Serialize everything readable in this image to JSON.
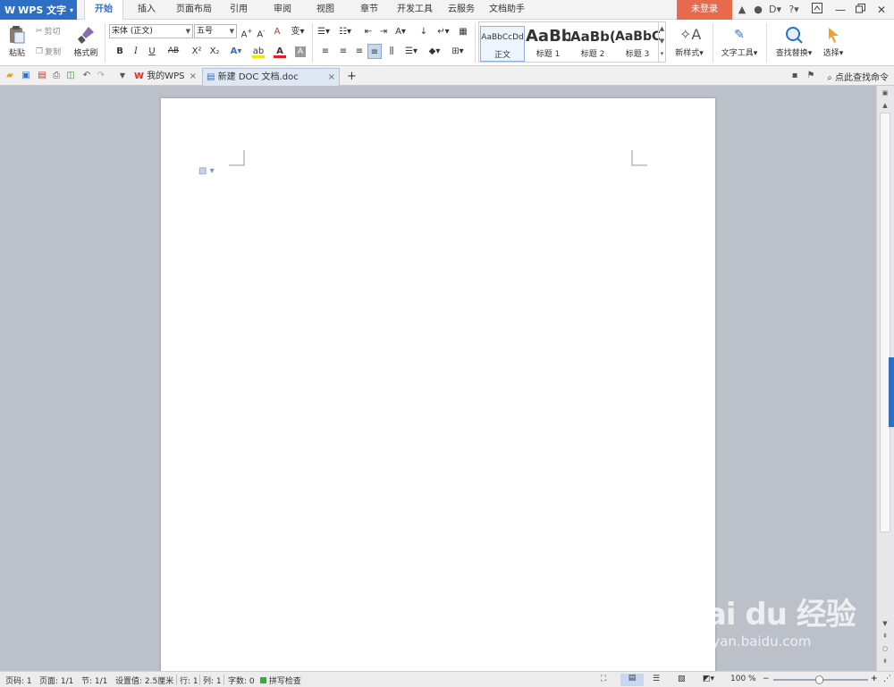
{
  "app": {
    "logo": "W",
    "name": "WPS 文字",
    "menu_arrow": "▾"
  },
  "menu_tabs": [
    {
      "label": "开始",
      "active": true
    },
    {
      "label": "插入"
    },
    {
      "label": "页面布局"
    },
    {
      "label": "引用"
    },
    {
      "label": "审阅"
    },
    {
      "label": "视图"
    },
    {
      "label": "章节"
    },
    {
      "label": "开发工具"
    },
    {
      "label": "云服务"
    },
    {
      "label": "文档助手"
    }
  ],
  "login_label": "未登录",
  "title_icons": [
    "▲",
    "●",
    "D▾",
    "?▾"
  ],
  "ribbon": {
    "paste": "粘贴",
    "cut": "剪切",
    "copy": "复制",
    "format_painter": "格式刷",
    "font_name": "宋体 (正文)",
    "font_size": "五号",
    "bold": "B",
    "italic": "I",
    "underline": "U",
    "strike": "AB",
    "superscript": "X²",
    "subscript": "X₂",
    "styles": [
      {
        "preview": "AaBbCcDd",
        "label": "正文",
        "weight": "normal",
        "size": 10
      },
      {
        "preview": "AaBb",
        "label": "标题 1",
        "weight": "bold",
        "size": 18
      },
      {
        "preview": "AaBb(",
        "label": "标题 2",
        "weight": "bold",
        "size": 15
      },
      {
        "preview": "AaBbC",
        "label": "标题 3",
        "weight": "bold",
        "size": 14
      }
    ],
    "new_style": "新样式",
    "text_tools": "文字工具",
    "find_replace": "查找替换",
    "select": "选择"
  },
  "doc_tabs": [
    {
      "label": "我的WPS",
      "close": "×"
    },
    {
      "label": "新建 DOC 文档.doc",
      "close": "×",
      "active": true
    }
  ],
  "add_tab": "+",
  "cmd_search": "点此查找命令",
  "status": {
    "page_num": "页码: 1",
    "pages": "页面: 1/1",
    "section": "节: 1/1",
    "setting": "设置值: 2.5厘米",
    "row": "行: 1",
    "col": "列: 1",
    "words": "字数: 0",
    "spell": "拼写检查",
    "zoom": "100 %"
  },
  "watermark": {
    "brand": "Bai du 经验",
    "url": "jingyan.baidu.com"
  },
  "colors": {
    "accent": "#2d6fc4",
    "login": "#e86a4c",
    "background": "#bcc0c8",
    "highlight_bar": "#f2e600",
    "font_color_bar": "#e02020"
  }
}
